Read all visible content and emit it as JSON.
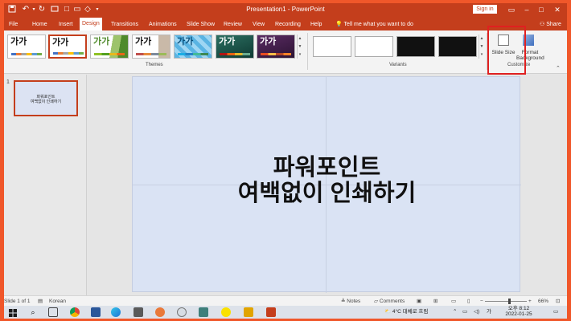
{
  "window": {
    "title": "Presentation1  -  PowerPoint",
    "signin": "Sign in"
  },
  "tabs": [
    "File",
    "Home",
    "Insert",
    "Design",
    "Transitions",
    "Animations",
    "Slide Show",
    "Review",
    "View",
    "Recording",
    "Help"
  ],
  "active_tab": "Design",
  "tell_me": "Tell me what you want to do",
  "share": "Share",
  "ribbon": {
    "theme_sample": "가가",
    "groups": {
      "themes": "Themes",
      "variants": "Variants",
      "customize": "Customize"
    },
    "customize": {
      "slide_size": "Slide Size",
      "format_background_1": "Format",
      "format_background_2": "Background"
    }
  },
  "slide_pane": {
    "number": "1",
    "thumb_line1": "파워포인트",
    "thumb_line2": "여백없이 인쇄하기"
  },
  "slide": {
    "line1": "파워포인트",
    "line2": "여백없이 인쇄하기"
  },
  "status": {
    "slide_count": "Slide 1 of 1",
    "language": "Korean",
    "notes": "Notes",
    "comments": "Comments",
    "zoom": "66%"
  },
  "taskbar": {
    "weather": "4°C 대체로 흐림",
    "ime": "가",
    "time": "오후 8:12",
    "date": "2022-01-25"
  },
  "colors": {
    "accent": "#c43e1c",
    "frame": "#f0572a",
    "slide_bg": "#dae3f4",
    "highlight_box": "#e02020"
  }
}
